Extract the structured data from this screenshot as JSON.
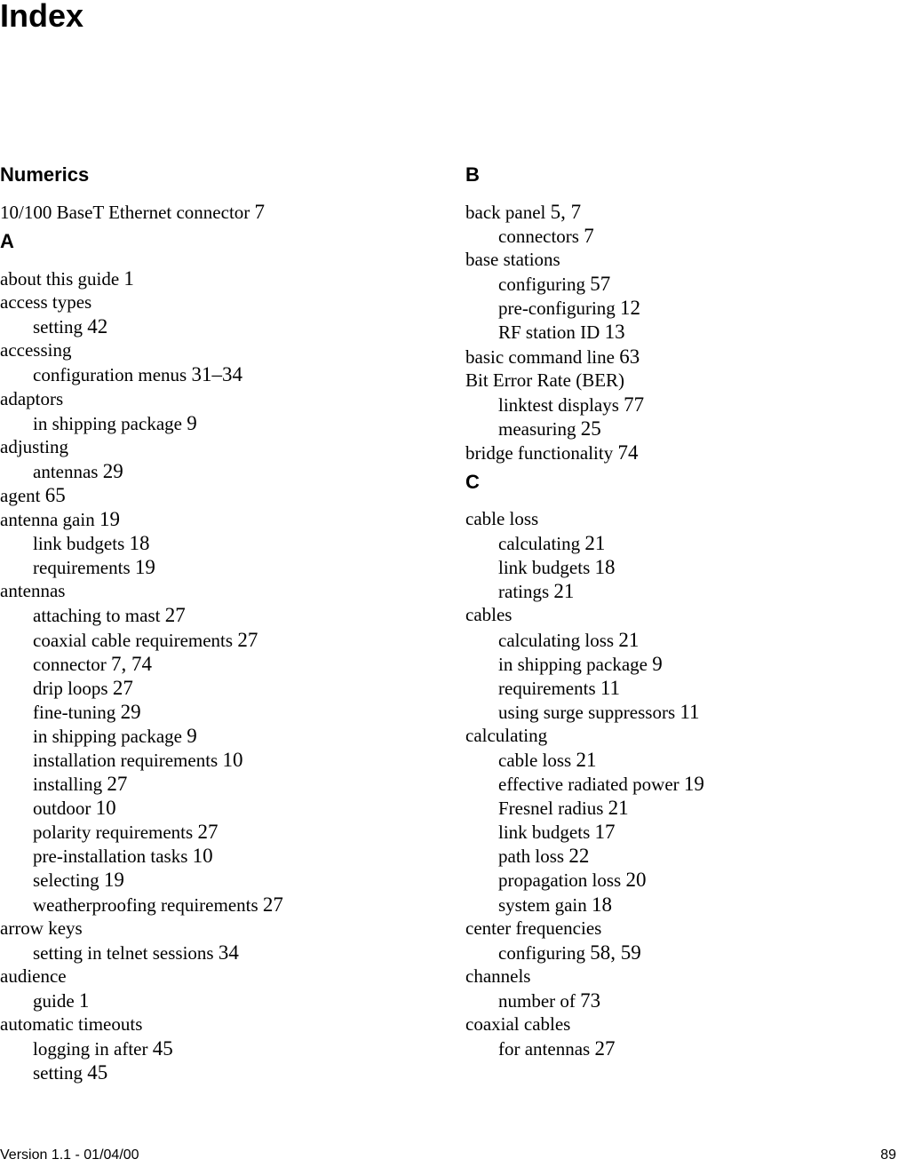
{
  "page": {
    "title": "Index",
    "footer": {
      "version": "Version 1.1 - 01/04/00",
      "page_number": "89"
    }
  },
  "left_column": [
    {
      "heading": "Numerics",
      "entries": [
        {
          "level": 1,
          "term": "10/100 BaseT Ethernet connector",
          "pages": "7"
        }
      ]
    },
    {
      "heading": "A",
      "entries": [
        {
          "level": 1,
          "term": "about this guide",
          "pages": "1"
        },
        {
          "level": 1,
          "term": "access types",
          "pages": ""
        },
        {
          "level": 2,
          "term": "setting",
          "pages": "42"
        },
        {
          "level": 1,
          "term": "accessing",
          "pages": ""
        },
        {
          "level": 2,
          "term": "configuration menus",
          "pages": "31–34"
        },
        {
          "level": 1,
          "term": "adaptors",
          "pages": ""
        },
        {
          "level": 2,
          "term": "in shipping package",
          "pages": "9"
        },
        {
          "level": 1,
          "term": "adjusting",
          "pages": ""
        },
        {
          "level": 2,
          "term": "antennas",
          "pages": "29"
        },
        {
          "level": 1,
          "term": "agent",
          "pages": "65"
        },
        {
          "level": 1,
          "term": "antenna gain",
          "pages": "19"
        },
        {
          "level": 2,
          "term": "link budgets",
          "pages": "18"
        },
        {
          "level": 2,
          "term": "requirements",
          "pages": "19"
        },
        {
          "level": 1,
          "term": "antennas",
          "pages": ""
        },
        {
          "level": 2,
          "term": "attaching to mast",
          "pages": "27"
        },
        {
          "level": 2,
          "term": "coaxial cable requirements",
          "pages": "27"
        },
        {
          "level": 2,
          "term": "connector",
          "pages": "7, 74"
        },
        {
          "level": 2,
          "term": "drip loops",
          "pages": "27"
        },
        {
          "level": 2,
          "term": "fine-tuning",
          "pages": "29"
        },
        {
          "level": 2,
          "term": "in shipping package",
          "pages": "9"
        },
        {
          "level": 2,
          "term": "installation requirements",
          "pages": "10"
        },
        {
          "level": 2,
          "term": "installing",
          "pages": "27"
        },
        {
          "level": 2,
          "term": "outdoor",
          "pages": "10"
        },
        {
          "level": 2,
          "term": "polarity requirements",
          "pages": "27"
        },
        {
          "level": 2,
          "term": "pre-installation tasks",
          "pages": "10"
        },
        {
          "level": 2,
          "term": "selecting",
          "pages": "19"
        },
        {
          "level": 2,
          "term": "weatherproofing requirements",
          "pages": "27"
        },
        {
          "level": 1,
          "term": "arrow keys",
          "pages": ""
        },
        {
          "level": 2,
          "term": "setting in telnet sessions",
          "pages": "34"
        },
        {
          "level": 1,
          "term": "audience",
          "pages": ""
        },
        {
          "level": 2,
          "term": "guide",
          "pages": "1"
        },
        {
          "level": 1,
          "term": "automatic timeouts",
          "pages": ""
        },
        {
          "level": 2,
          "term": "logging in after",
          "pages": "45"
        },
        {
          "level": 2,
          "term": "setting",
          "pages": "45"
        }
      ]
    }
  ],
  "right_column": [
    {
      "heading": "B",
      "entries": [
        {
          "level": 1,
          "term": "back panel",
          "pages": "5, 7"
        },
        {
          "level": 2,
          "term": "connectors",
          "pages": "7"
        },
        {
          "level": 1,
          "term": "base stations",
          "pages": ""
        },
        {
          "level": 2,
          "term": "configuring",
          "pages": "57"
        },
        {
          "level": 2,
          "term": "pre-configuring",
          "pages": "12"
        },
        {
          "level": 2,
          "term": "RF station ID",
          "pages": "13"
        },
        {
          "level": 1,
          "term": "basic command line",
          "pages": "63"
        },
        {
          "level": 1,
          "term": "Bit Error Rate (BER)",
          "pages": ""
        },
        {
          "level": 2,
          "term": "linktest displays",
          "pages": "77"
        },
        {
          "level": 2,
          "term": "measuring",
          "pages": "25"
        },
        {
          "level": 1,
          "term": "bridge functionality",
          "pages": "74"
        }
      ]
    },
    {
      "heading": "C",
      "entries": [
        {
          "level": 1,
          "term": "cable loss",
          "pages": ""
        },
        {
          "level": 2,
          "term": "calculating",
          "pages": "21"
        },
        {
          "level": 2,
          "term": "link budgets",
          "pages": "18"
        },
        {
          "level": 2,
          "term": "ratings",
          "pages": "21"
        },
        {
          "level": 1,
          "term": "cables",
          "pages": ""
        },
        {
          "level": 2,
          "term": "calculating loss",
          "pages": "21"
        },
        {
          "level": 2,
          "term": "in shipping package",
          "pages": "9"
        },
        {
          "level": 2,
          "term": "requirements",
          "pages": "11"
        },
        {
          "level": 2,
          "term": "using surge suppressors",
          "pages": "11"
        },
        {
          "level": 1,
          "term": "calculating",
          "pages": ""
        },
        {
          "level": 2,
          "term": "cable loss",
          "pages": "21"
        },
        {
          "level": 2,
          "term": "effective radiated power",
          "pages": "19"
        },
        {
          "level": 2,
          "term": "Fresnel radius",
          "pages": "21"
        },
        {
          "level": 2,
          "term": "link budgets",
          "pages": "17"
        },
        {
          "level": 2,
          "term": "path loss",
          "pages": "22"
        },
        {
          "level": 2,
          "term": "propagation loss",
          "pages": "20"
        },
        {
          "level": 2,
          "term": "system gain",
          "pages": "18"
        },
        {
          "level": 1,
          "term": "center frequencies",
          "pages": ""
        },
        {
          "level": 2,
          "term": "configuring",
          "pages": "58, 59"
        },
        {
          "level": 1,
          "term": "channels",
          "pages": ""
        },
        {
          "level": 2,
          "term": "number of",
          "pages": "73"
        },
        {
          "level": 1,
          "term": "coaxial cables",
          "pages": ""
        },
        {
          "level": 2,
          "term": "for antennas",
          "pages": "27"
        }
      ]
    }
  ]
}
